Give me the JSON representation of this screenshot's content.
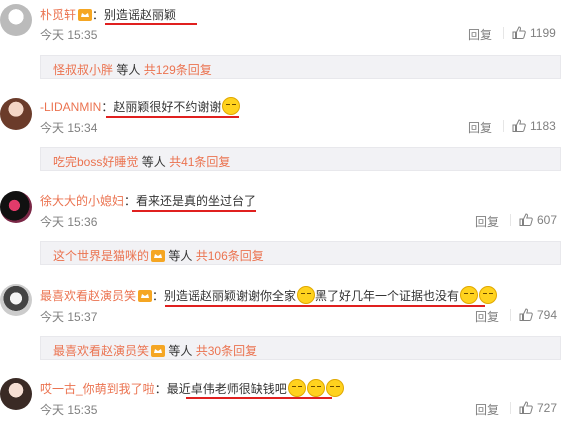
{
  "comments": [
    {
      "user": "朴觅轩",
      "colon": "：",
      "text": "别造谣赵丽颖",
      "emoji_count": 0,
      "time": "今天 15:35",
      "reply": "回复",
      "likes": "1199",
      "sub": {
        "user": "怪叔叔小胖",
        "suffix": "等人",
        "total": "共129条回复"
      }
    },
    {
      "user": "-LIDANMIN",
      "colon": "：",
      "text": "赵丽颖很好不约谢谢",
      "emoji_count": 1,
      "time": "今天 15:34",
      "reply": "回复",
      "likes": "1183",
      "sub": {
        "user": "吃完boss好睡觉",
        "suffix": "等人",
        "total": "共41条回复"
      }
    },
    {
      "user": "徐大大的小媳妇",
      "colon": "：",
      "text": "看来还是真的坐过台了",
      "emoji_count": 0,
      "time": "今天 15:36",
      "reply": "回复",
      "likes": "607",
      "sub": {
        "user": "这个世界是猫咪的",
        "suffix": "等人",
        "total": "共106条回复"
      }
    },
    {
      "user": "最喜欢看赵演员笑",
      "colon": "：",
      "text_a": "别造谣赵丽颖谢谢你全家",
      "text_b": "黑了好几年一个证据也没有",
      "time": "今天 15:37",
      "reply": "回复",
      "likes": "794",
      "sub": {
        "user": "最喜欢看赵演员笑",
        "suffix": "等人",
        "total": "共30条回复"
      }
    },
    {
      "user": "哎一古_你萌到我了啦",
      "colon": "：",
      "text": "最近卓伟老师很缺钱吧",
      "emoji_count": 3,
      "time": "今天 15:35",
      "reply": "回复",
      "likes": "727"
    }
  ],
  "colors": {
    "username": "#eb7350",
    "underline": "#e0201f",
    "meta": "#808080",
    "subbox_bg": "#f2f2f5",
    "vip_badge": "#f5a623"
  },
  "icons": {
    "vip": "vip-crown-icon",
    "like": "thumbs-up-icon",
    "emoji": "smile-emoji-icon"
  }
}
